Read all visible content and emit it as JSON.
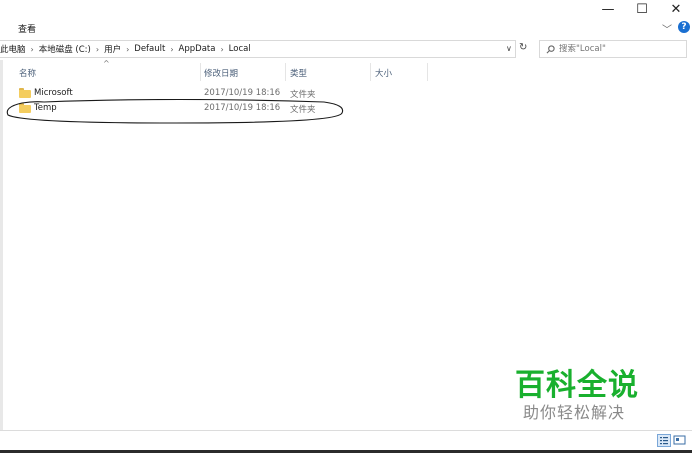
{
  "window": {
    "minimize": "—",
    "maximize": "☐",
    "close": "✕"
  },
  "ribbon": {
    "tab_view": "查看",
    "expand": "﹀",
    "help": "?"
  },
  "address": {
    "crumbs": [
      "此电脑",
      "本地磁盘 (C:)",
      "用户",
      "Default",
      "AppData",
      "Local"
    ],
    "separator": "›",
    "dropdown": "∨",
    "refresh": "↻"
  },
  "search": {
    "placeholder": "搜索\"Local\""
  },
  "columns": {
    "name": "名称",
    "date": "修改日期",
    "type": "类型",
    "size": "大小",
    "sort_indicator": "^"
  },
  "rows": [
    {
      "name": "Microsoft",
      "date": "2017/10/19 18:16",
      "type": "文件夹"
    },
    {
      "name": "Temp",
      "date": "2017/10/19 18:16",
      "type": "文件夹"
    }
  ],
  "watermark": {
    "title": "百科全说",
    "subtitle": "助你轻松解决"
  },
  "icons": [
    "minimize-icon",
    "maximize-icon",
    "close-icon",
    "help-icon",
    "refresh-icon",
    "search-icon",
    "folder-icon",
    "details-view-icon",
    "tiles-view-icon"
  ],
  "colors": {
    "accent": "#1a6fd1",
    "folder": "#f4cd5f",
    "watermark_green": "#19b02e",
    "header_text": "#4c607a"
  }
}
